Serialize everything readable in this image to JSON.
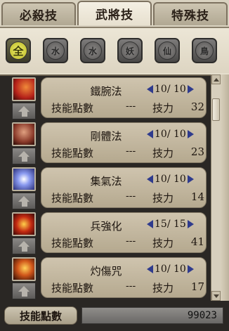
{
  "tabs": [
    {
      "label": "必殺技",
      "active": false
    },
    {
      "label": "武將技",
      "active": true
    },
    {
      "label": "特殊技",
      "active": false
    }
  ],
  "filters": [
    {
      "glyph": "全",
      "selected": true
    },
    {
      "glyph": "水",
      "selected": false
    },
    {
      "glyph": "水",
      "selected": false
    },
    {
      "glyph": "妖",
      "selected": false
    },
    {
      "glyph": "仙",
      "selected": false
    },
    {
      "glyph": "鳥",
      "selected": false
    }
  ],
  "skills": [
    {
      "name": "鐵腕法",
      "level": "10/ 10",
      "points_label": "技能點數",
      "points": "---",
      "power_label": "技力",
      "power": "32",
      "icon_color": "#b5221a"
    },
    {
      "name": "剛體法",
      "level": "10/ 10",
      "points_label": "技能點數",
      "points": "---",
      "power_label": "技力",
      "power": "23",
      "icon_color": "#8a3a2a"
    },
    {
      "name": "集氣法",
      "level": "10/ 10",
      "points_label": "技能點數",
      "points": "---",
      "power_label": "技力",
      "power": "14",
      "icon_color": "#5a6ad0"
    },
    {
      "name": "兵強化",
      "level": "15/ 15",
      "points_label": "技能點數",
      "points": "---",
      "power_label": "技力",
      "power": "41",
      "icon_color": "#c42a12"
    },
    {
      "name": "灼傷咒",
      "level": "10/ 10",
      "points_label": "技能點數",
      "points": "---",
      "power_label": "技力",
      "power": "17",
      "icon_color": "#d0561a"
    }
  ],
  "footer": {
    "label": "技能點數",
    "value": "99023"
  },
  "colors": {
    "accent_arrow": "#2f3b8d",
    "panel": "#cfc4ae"
  }
}
